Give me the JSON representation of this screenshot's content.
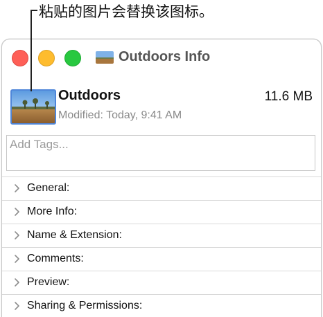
{
  "callout": {
    "text": "粘贴的图片会替换该图标。"
  },
  "window": {
    "title": "Outdoors Info"
  },
  "file": {
    "name": "Outdoors",
    "size": "11.6 MB",
    "modified": "Modified: Today, 9:41 AM"
  },
  "tags": {
    "placeholder": "Add Tags..."
  },
  "sections": [
    {
      "label": "General:"
    },
    {
      "label": "More Info:"
    },
    {
      "label": "Name & Extension:"
    },
    {
      "label": "Comments:"
    },
    {
      "label": "Preview:"
    },
    {
      "label": "Sharing & Permissions:"
    }
  ],
  "colors": {
    "close": "#fe5f57",
    "minimize": "#febc2e",
    "maximize": "#28c840",
    "selection": "#4f86d9"
  }
}
